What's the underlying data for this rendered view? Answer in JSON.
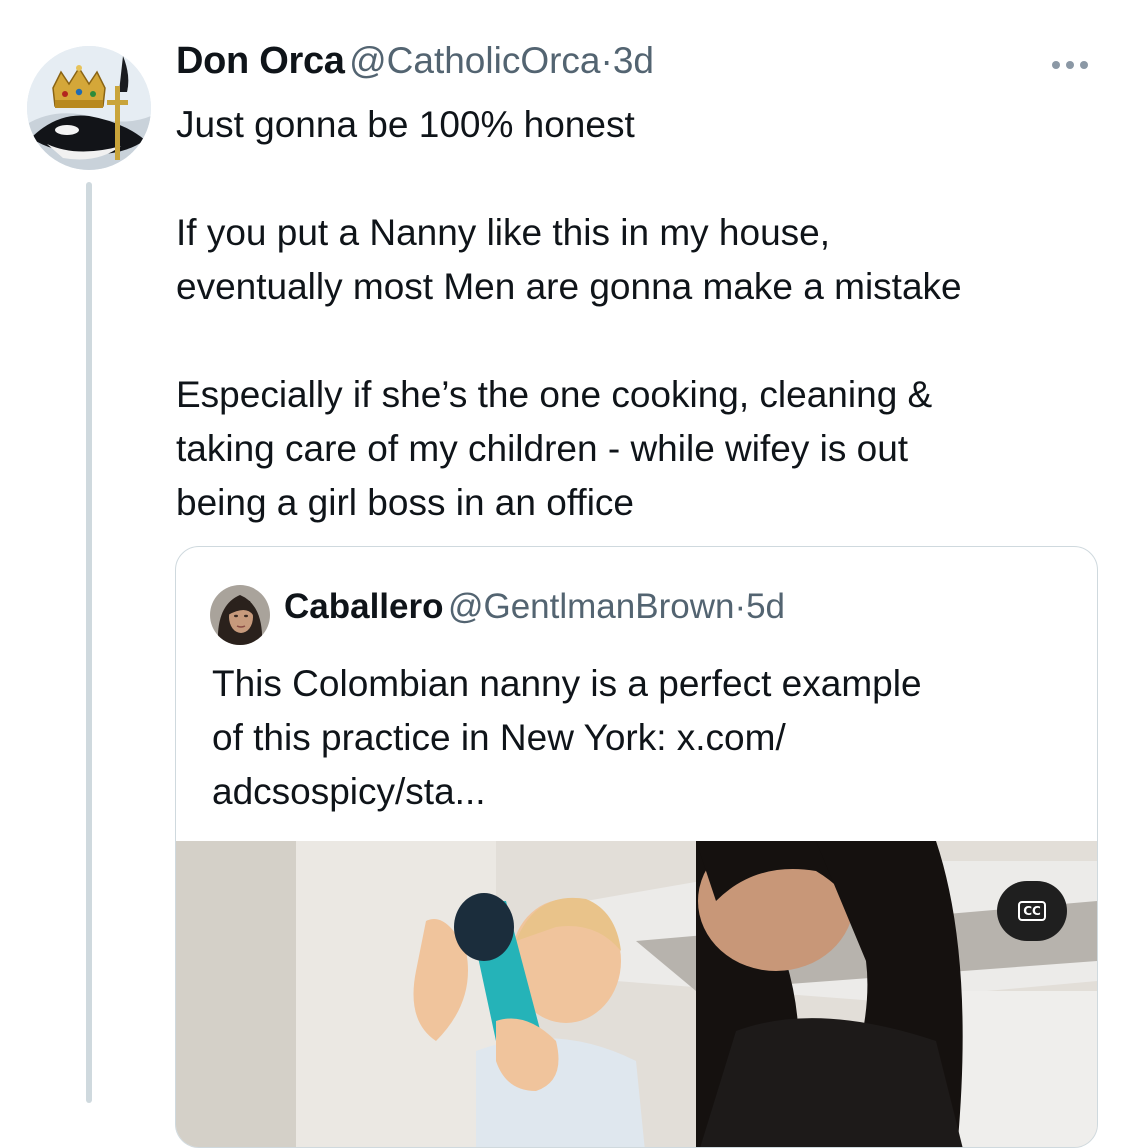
{
  "tweet": {
    "author_name": "Don Orca",
    "handle": "@CatholicOrca",
    "separator": "·",
    "time": "3d",
    "avatar_icon": "orca-crown-sword-avatar",
    "more_icon": "more-dots-icon",
    "lines": [
      "Just gonna be 100% honest",
      "",
      "If you put a Nanny like this in my house,",
      "eventually most Men are gonna make a mistake",
      "",
      "Especially if she’s the one cooking, cleaning &",
      "taking care of my children - while wifey is out",
      "being a girl boss in an office"
    ]
  },
  "quote": {
    "author_name": "Caballero",
    "handle": "@GentlmanBrown",
    "separator": "·",
    "time": "5d",
    "avatar_icon": "woman-portrait-avatar",
    "lines": [
      "This Colombian nanny is a perfect example",
      "of this practice in New York: x.com/",
      "adcsospicy/sta..."
    ],
    "media": {
      "type": "video-thumbnail",
      "cc_label": "CC"
    }
  },
  "colors": {
    "text": "#0f1419",
    "secondary": "#536471",
    "border": "#cfd9de",
    "thread_line": "#cfd9de"
  }
}
